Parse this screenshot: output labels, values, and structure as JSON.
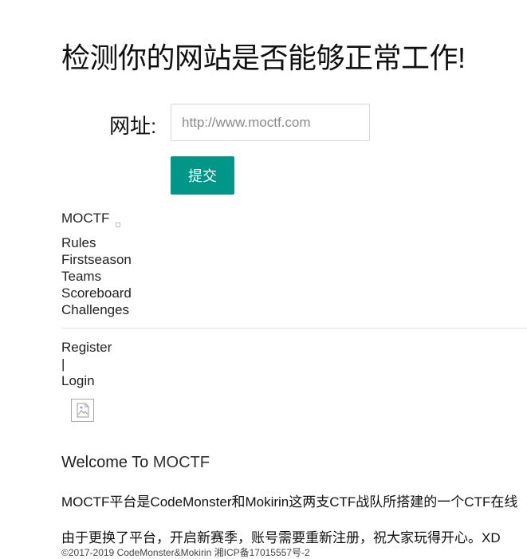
{
  "form": {
    "heading": "检测你的网站是否能够正常工作!",
    "url_label": "网址:",
    "url_placeholder": "http://www.moctf.com",
    "url_value": "",
    "submit_label": "提交"
  },
  "site": {
    "brand": "MOCTF",
    "nav": {
      "items": [
        {
          "label": "Rules"
        },
        {
          "label": "Firstseason"
        },
        {
          "label": "Teams"
        },
        {
          "label": "Scoreboard"
        },
        {
          "label": "Challenges"
        }
      ]
    },
    "auth": {
      "register": "Register",
      "separator": "|",
      "login": "Login"
    },
    "welcome": {
      "prefix": "Welcome To ",
      "name": "MOCTF"
    },
    "intro": "MOCTF平台是CodeMonster和Mokirin这两支CTF战队所搭建的一个CTF在线",
    "notice": "由于更换了平台，开启新赛季，账号需要重新注册，祝大家玩得开心。XD",
    "footer": "©2017-2019 CodeMonster&Mokirin 湘ICP备17015557号-2"
  }
}
